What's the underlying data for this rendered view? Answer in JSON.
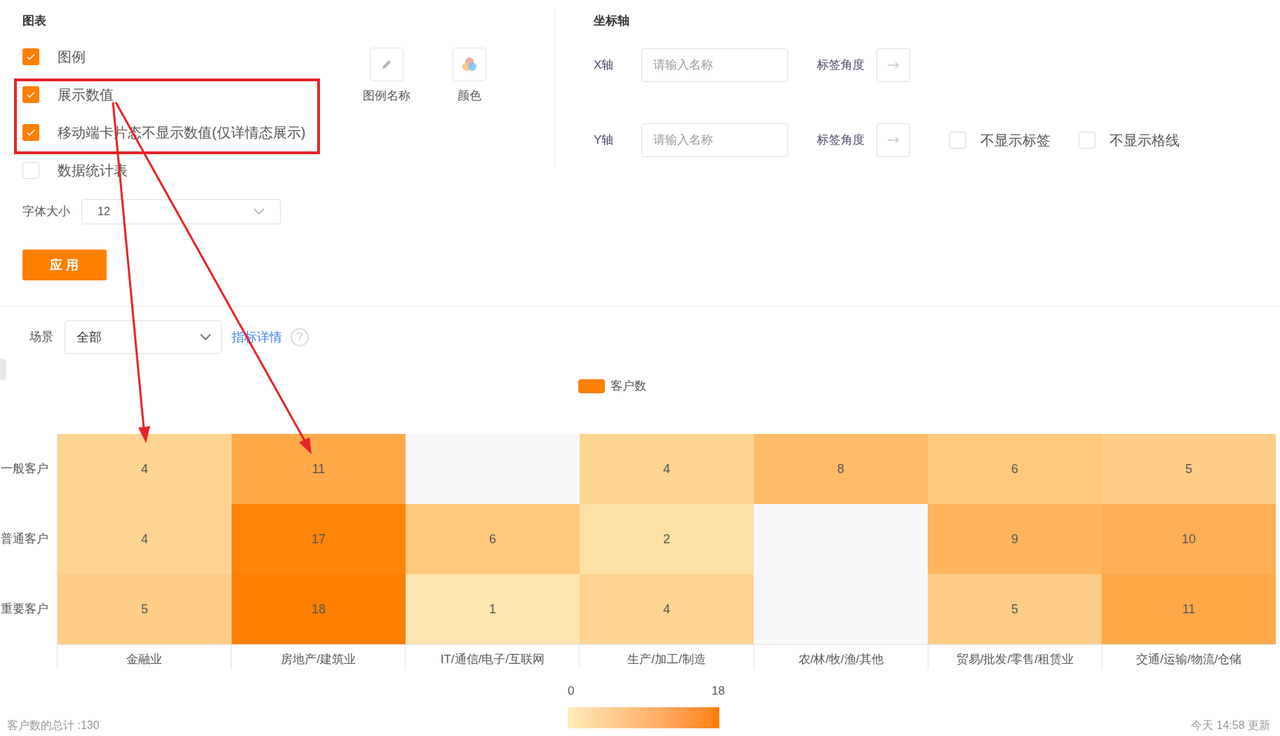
{
  "chart_settings": {
    "title": "图表",
    "options": [
      {
        "label": "图例",
        "checked": true
      },
      {
        "label": "展示数值",
        "checked": true
      },
      {
        "label": "移动端卡片态不显示数值(仅详情态展示)",
        "checked": true
      },
      {
        "label": "数据统计表",
        "checked": false
      }
    ],
    "tools": [
      {
        "kind": "pencil",
        "label": "图例名称"
      },
      {
        "kind": "palette",
        "label": "颜色"
      }
    ],
    "font_size": {
      "label": "字体大小",
      "value": "12"
    },
    "apply_button": "应 用"
  },
  "axis_settings": {
    "title": "坐标轴",
    "axes": [
      {
        "label": "X轴",
        "placeholder": "请输入名称",
        "angle_label": "标签角度"
      },
      {
        "label": "Y轴",
        "placeholder": "请输入名称",
        "angle_label": "标签角度",
        "options": [
          {
            "label": "不显示标签",
            "checked": false
          },
          {
            "label": "不显示格线",
            "checked": false
          }
        ]
      }
    ]
  },
  "filter": {
    "label": "场景",
    "value": "全部",
    "link": "指标详情",
    "help": "?"
  },
  "legend": {
    "label": "客户数",
    "color": "#ff7f00"
  },
  "heatmap": {
    "rows": [
      "一般客户",
      "普通客户",
      "重要客户"
    ],
    "columns": [
      "金融业",
      "房地产/建筑业",
      "IT/通信/电子/互联网",
      "生产/加工/制造",
      "农/林/牧/渔/其他",
      "贸易/批发/零售/租赁业",
      "交通/运输/物流/仓储"
    ],
    "cells": [
      [
        "4",
        "11",
        null,
        "4",
        "8",
        "6",
        "5"
      ],
      [
        "4",
        "17",
        "6",
        "2",
        null,
        "9",
        "10"
      ],
      [
        "5",
        "18",
        "1",
        "4",
        null,
        "5",
        "11"
      ]
    ]
  },
  "visual_map": {
    "min": "0",
    "max": "18"
  },
  "footer": {
    "total": "客户数的总计 :130",
    "updated": "今天 14:58 更新"
  }
}
